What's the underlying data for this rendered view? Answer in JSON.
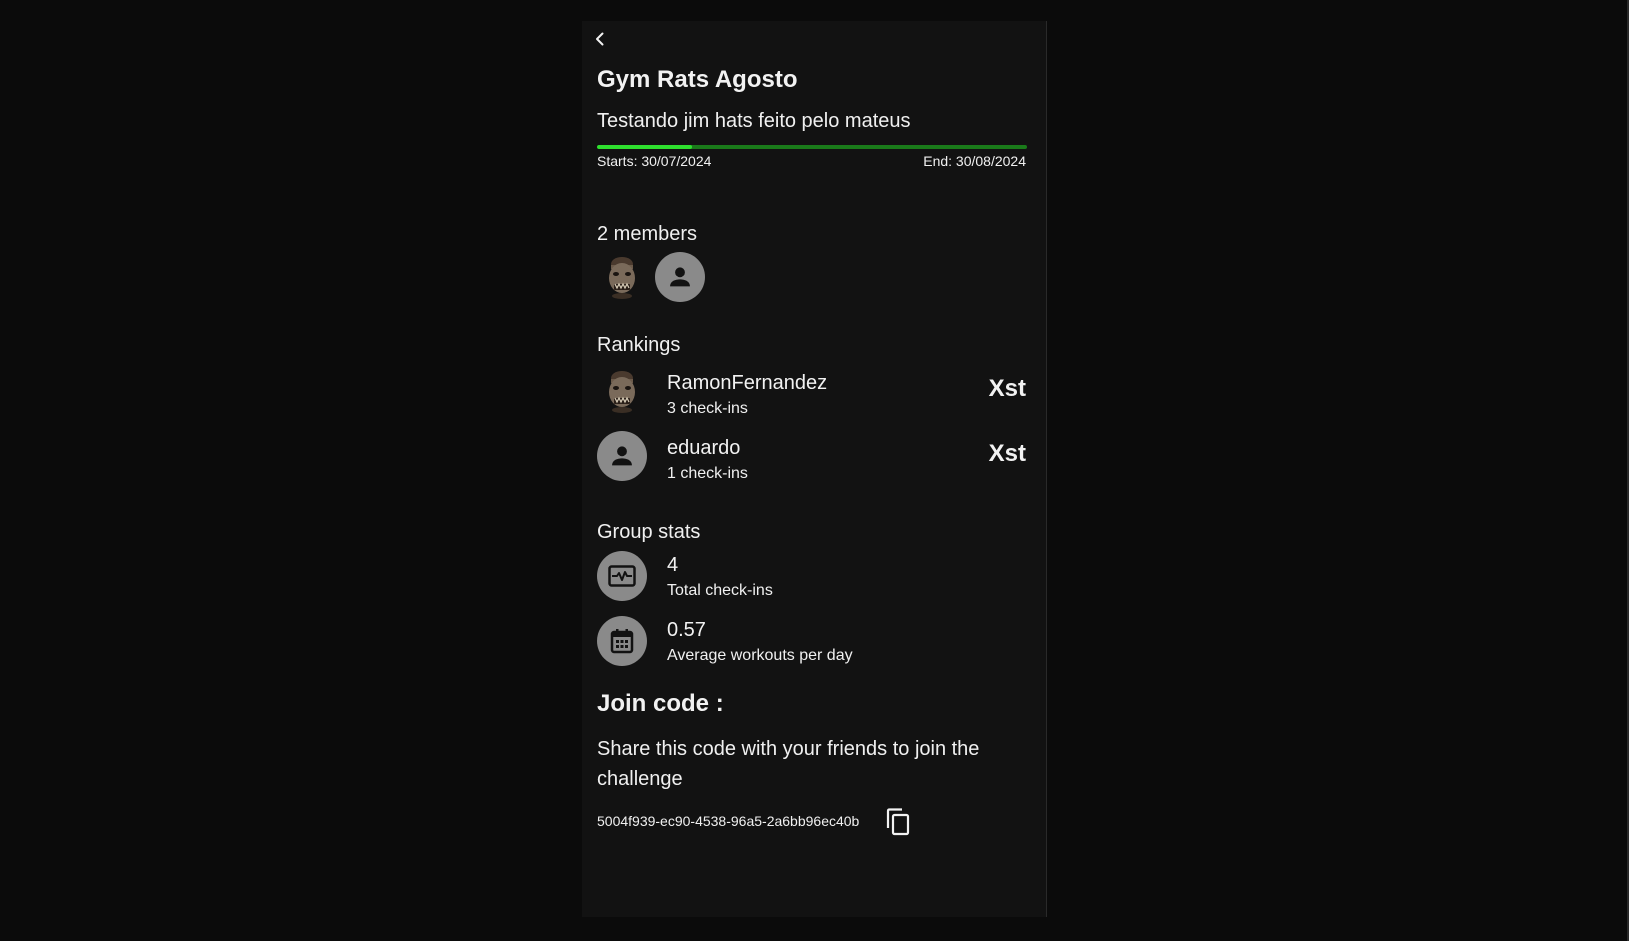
{
  "challenge": {
    "title": "Gym Rats Agosto",
    "description": "Testando jim hats feito pelo mateus",
    "starts": "Starts: 30/07/2024",
    "ends": "End: 30/08/2024",
    "progress_fraction": 0.22
  },
  "members": {
    "label": "2 members",
    "avatars": [
      {
        "name": "RamonFernandez",
        "icon": "ogre-avatar-icon"
      },
      {
        "name": "eduardo",
        "icon": "person-icon"
      }
    ]
  },
  "rankings": {
    "label": "Rankings",
    "items": [
      {
        "name": "RamonFernandez",
        "checkins": "3 check-ins",
        "badge": "Xst",
        "icon": "ogre-avatar-icon"
      },
      {
        "name": "eduardo",
        "checkins": "1 check-ins",
        "badge": "Xst",
        "icon": "person-icon"
      }
    ]
  },
  "group_stats": {
    "label": "Group stats",
    "items": [
      {
        "value": "4",
        "label": "Total check-ins",
        "icon": "activity-icon"
      },
      {
        "value": "0.57",
        "label": "Average workouts per day",
        "icon": "calendar-icon"
      }
    ]
  },
  "join": {
    "title": "Join code :",
    "description": "Share this code with your friends to join the challenge",
    "code": "5004f939-ec90-4538-96a5-2a6bb96ec40b",
    "copy_icon": "copy-icon"
  },
  "colors": {
    "background": "#0b0b0b",
    "panel": "#121212",
    "progress_fill": "#2ee02e",
    "progress_track": "#1a7a1a",
    "avatar_gray": "#8a8a8a"
  }
}
